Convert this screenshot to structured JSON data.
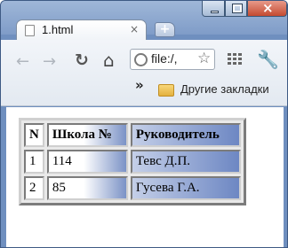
{
  "browser": {
    "tab_title": "1.html",
    "tab_close": "×",
    "address_text": "file:/,",
    "bookmarks_chevron": "»",
    "bookmarks_folder_label": "Другие закладки"
  },
  "table": {
    "headers": [
      "N",
      "Школа №",
      "Руководитель"
    ],
    "rows": [
      [
        "1",
        "114",
        "Тевс Д.П."
      ],
      [
        "2",
        "85",
        "Гусева Г.А."
      ]
    ]
  },
  "icons": {
    "back": "back-arrow-icon",
    "forward": "forward-arrow-icon",
    "reload": "reload-icon",
    "home": "home-icon",
    "star": "star-icon",
    "apps": "grid-icon",
    "settings": "wrench-icon"
  },
  "colors": {
    "window_frame": "#7f9cc8",
    "close_button": "#c44a31",
    "table_gradient_blue": "#6d87c3"
  }
}
